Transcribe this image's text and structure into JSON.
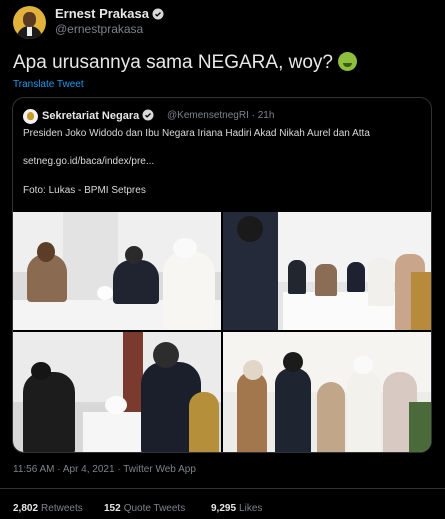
{
  "author": {
    "name": "Ernest Prakasa",
    "handle": "@ernestprakasa"
  },
  "tweet": {
    "text": "Apa urusannya sama NEGARA, woy?",
    "emoji": "nauseated-face-emoji",
    "translate": "Translate Tweet"
  },
  "quoted": {
    "name": "Sekretariat Negara",
    "meta": "@KemensetnegRI · 21h",
    "headline": "Presiden Joko Widodo dan Ibu Negara Iriana Hadiri Akad Nikah Aurel dan Atta",
    "link": "setneg.go.id/baca/index/pre...",
    "credit": "Foto: Lukas - BPMI Setpres"
  },
  "footer": {
    "timestamp": "11:56 AM · Apr 4, 2021 · Twitter Web App",
    "retweets_count": "2,802",
    "retweets_label": "Retweets",
    "quotes_count": "152",
    "quotes_label": "Quote Tweets",
    "likes_count": "9,295",
    "likes_label": "Likes"
  },
  "colors": {
    "background": "#000000",
    "link": "#1d9bf0",
    "verified": "#1d9bf0",
    "muted": "#7b8389"
  }
}
